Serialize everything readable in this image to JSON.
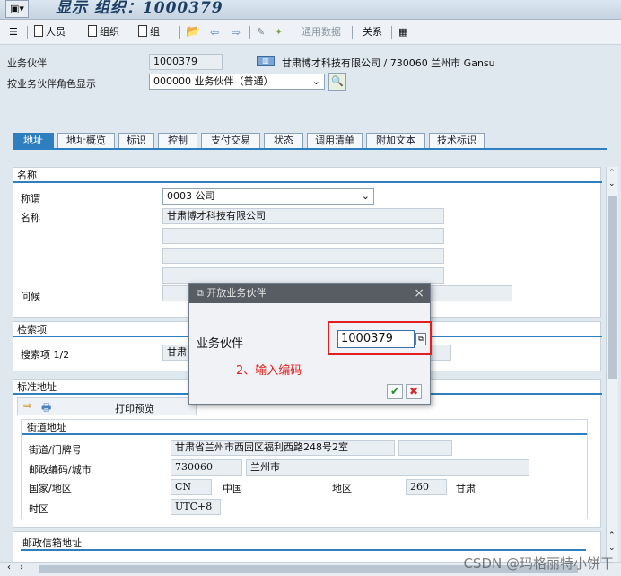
{
  "app": {
    "window_title": "显示 组织：1000379"
  },
  "toolbar": {
    "person_label": "人员",
    "org_label": "组织",
    "group_label": "组",
    "general_data_label": "通用数据",
    "relations_label": "关系"
  },
  "header": {
    "bp_label": "业务伙伴",
    "bp_value": "1000379",
    "bp_desc": "甘肃博才科技有限公司 / 730060 兰州市 Gansu",
    "role_label": "按业务伙伴角色显示",
    "role_value": "000000 业务伙伴（普通）"
  },
  "tabs": [
    "地址",
    "地址概览",
    "标识",
    "控制",
    "支付交易",
    "状态",
    "调用清单",
    "附加文本",
    "技术标识"
  ],
  "name_section": {
    "title": "名称",
    "salutation_label": "称谓",
    "salutation_value": "0003 公司",
    "name_label": "名称",
    "name_value": "甘肃博才科技有限公司",
    "greeting_label": "问候"
  },
  "search_section": {
    "title": "检索项",
    "search_label": "搜索项 1/2",
    "search_value": "甘肃"
  },
  "std_address": {
    "title": "标准地址",
    "print_preview_label": "打印预览",
    "street_section_title": "街道地址",
    "street_label": "街道/门牌号",
    "street_value": "甘肃省兰州市西固区福利西路248号2室",
    "postal_label": "邮政编码/城市",
    "postal_value": "730060",
    "city_value": "兰州市",
    "country_label": "国家/地区",
    "country_code": "CN",
    "country_name": "中国",
    "region_label": "地区",
    "region_code": "260",
    "region_name": "甘肃",
    "timezone_label": "时区",
    "timezone_value": "UTC+8"
  },
  "pobox_section": {
    "title": "邮政信箱地址"
  },
  "popup": {
    "title": "开放业务伙伴",
    "field_label": "业务伙伴",
    "field_value": "1000379",
    "annotation": "2、输入编码"
  },
  "watermark": "CSDN @玛格丽特小饼干",
  "colors": {
    "accent": "#2e7fc0",
    "annotation_red": "#e02020"
  }
}
